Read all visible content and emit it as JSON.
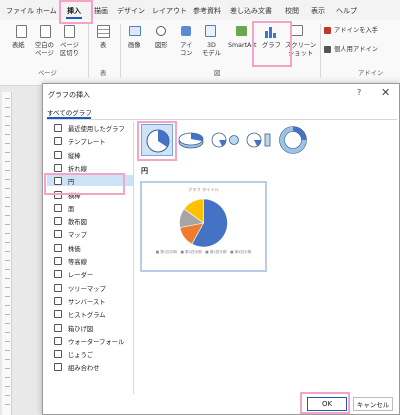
{
  "ribbon_tabs": [
    "ファイル",
    "ホーム",
    "挿入",
    "描画",
    "デザイン",
    "レイアウト",
    "参考資料",
    "差し込み文書",
    "校閲",
    "表示",
    "ヘルプ"
  ],
  "ribbon": {
    "cover_page": "表紙",
    "blank_page": "空白の\nページ",
    "page_break": "ページ\n区切り",
    "table": "表",
    "image": "画像",
    "shapes": "図形",
    "icons": "アイ\nコン",
    "model3d": "3D\nモデル",
    "smartart": "SmartArt",
    "chart": "グラフ",
    "screenshot": "スクリーン\nショット",
    "get_addins": "アドインを入手",
    "personal_addins": "個人用アドイン",
    "group_pages": "ページ",
    "group_table": "表",
    "group_illustrations": "図",
    "group_addins": "アドイン"
  },
  "dialog": {
    "title": "グラフの挿入",
    "help": "?",
    "close": "✕",
    "tab_all": "すべてのグラフ",
    "ok": "OK",
    "cancel": "キャンセル",
    "selected_type_title": "円"
  },
  "chart_types": [
    {
      "label": "最近使用したグラフ",
      "icon": "recent-icon"
    },
    {
      "label": "テンプレート",
      "icon": "template-icon"
    },
    {
      "label": "縦棒",
      "icon": "column-chart-icon"
    },
    {
      "label": "折れ線",
      "icon": "line-chart-icon"
    },
    {
      "label": "円",
      "icon": "pie-chart-icon"
    },
    {
      "label": "横棒",
      "icon": "bar-chart-icon"
    },
    {
      "label": "面",
      "icon": "area-chart-icon"
    },
    {
      "label": "散布図",
      "icon": "scatter-chart-icon"
    },
    {
      "label": "マップ",
      "icon": "map-chart-icon"
    },
    {
      "label": "株価",
      "icon": "stock-chart-icon"
    },
    {
      "label": "等高線",
      "icon": "surface-chart-icon"
    },
    {
      "label": "レーダー",
      "icon": "radar-chart-icon"
    },
    {
      "label": "ツリーマップ",
      "icon": "treemap-chart-icon"
    },
    {
      "label": "サンバースト",
      "icon": "sunburst-chart-icon"
    },
    {
      "label": "ヒストグラム",
      "icon": "histogram-chart-icon"
    },
    {
      "label": "箱ひげ図",
      "icon": "box-whisker-chart-icon"
    },
    {
      "label": "ウォーターフォール",
      "icon": "waterfall-chart-icon"
    },
    {
      "label": "じょうご",
      "icon": "funnel-chart-icon"
    },
    {
      "label": "組み合わせ",
      "icon": "combo-chart-icon"
    }
  ],
  "selected_index": 4,
  "subtypes": [
    {
      "name": "pie-subtype-icon",
      "selected": true
    },
    {
      "name": "3d-pie-subtype-icon",
      "selected": false
    },
    {
      "name": "pie-of-pie-subtype-icon",
      "selected": false
    },
    {
      "name": "bar-of-pie-subtype-icon",
      "selected": false
    },
    {
      "name": "doughnut-subtype-icon",
      "selected": false
    }
  ],
  "preview": {
    "title": "グラフ タイトル",
    "legend": "■ 第1四半期　■ 第2四半期　■ 第3四半期　■ 第4四半期",
    "slices": [
      {
        "value": 58,
        "color": "#4472c4"
      },
      {
        "value": 14,
        "color": "#ed7d31"
      },
      {
        "value": 13,
        "color": "#a5a5a5"
      },
      {
        "value": 15,
        "color": "#ffc000"
      }
    ]
  },
  "colors": {
    "accent": "#185abd",
    "highlight": "#f4a4c7",
    "selected_bg": "#cde2f7"
  }
}
